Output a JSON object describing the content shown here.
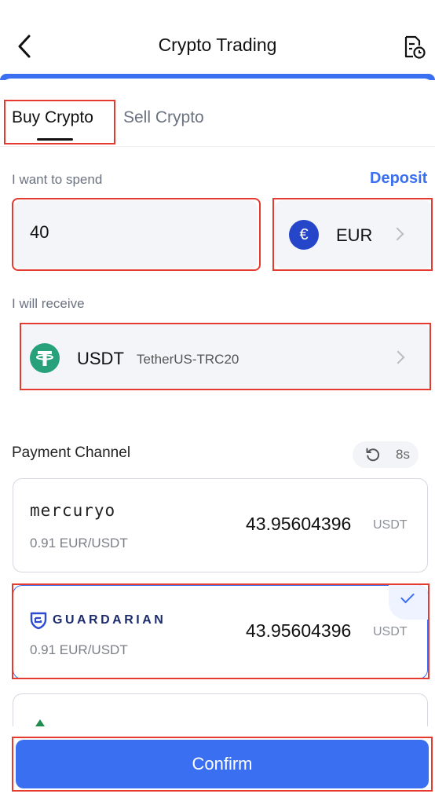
{
  "header": {
    "title": "Crypto Trading"
  },
  "tabs": {
    "buy": "Buy Crypto",
    "sell": "Sell Crypto"
  },
  "spend": {
    "label": "I want to spend",
    "deposit_link": "Deposit",
    "amount": "40",
    "currency_code": "EUR",
    "currency_symbol": "€"
  },
  "receive": {
    "label": "I will receive",
    "currency_code": "USDT",
    "network": "TetherUS-TRC20"
  },
  "payment": {
    "title": "Payment Channel",
    "refresh_countdown": "8s",
    "channels": [
      {
        "brand": "mercuryo",
        "rate": "0.91 EUR/USDT",
        "amount": "43.95604396",
        "unit": "USDT",
        "selected": false
      },
      {
        "brand": "GUARDARIAN",
        "rate": "0.91 EUR/USDT",
        "amount": "43.95604396",
        "unit": "USDT",
        "selected": true
      }
    ]
  },
  "footer": {
    "confirm_label": "Confirm"
  },
  "colors": {
    "accent": "#3a6ff2",
    "highlight": "#e53a2f",
    "tether": "#27a17a",
    "euro": "#2546c9"
  },
  "icons": [
    "back-arrow-icon",
    "order-history-icon",
    "euro-icon",
    "tether-icon",
    "chevron-right-icon",
    "refresh-icon",
    "guardarian-logo-icon",
    "checkmark-icon"
  ]
}
